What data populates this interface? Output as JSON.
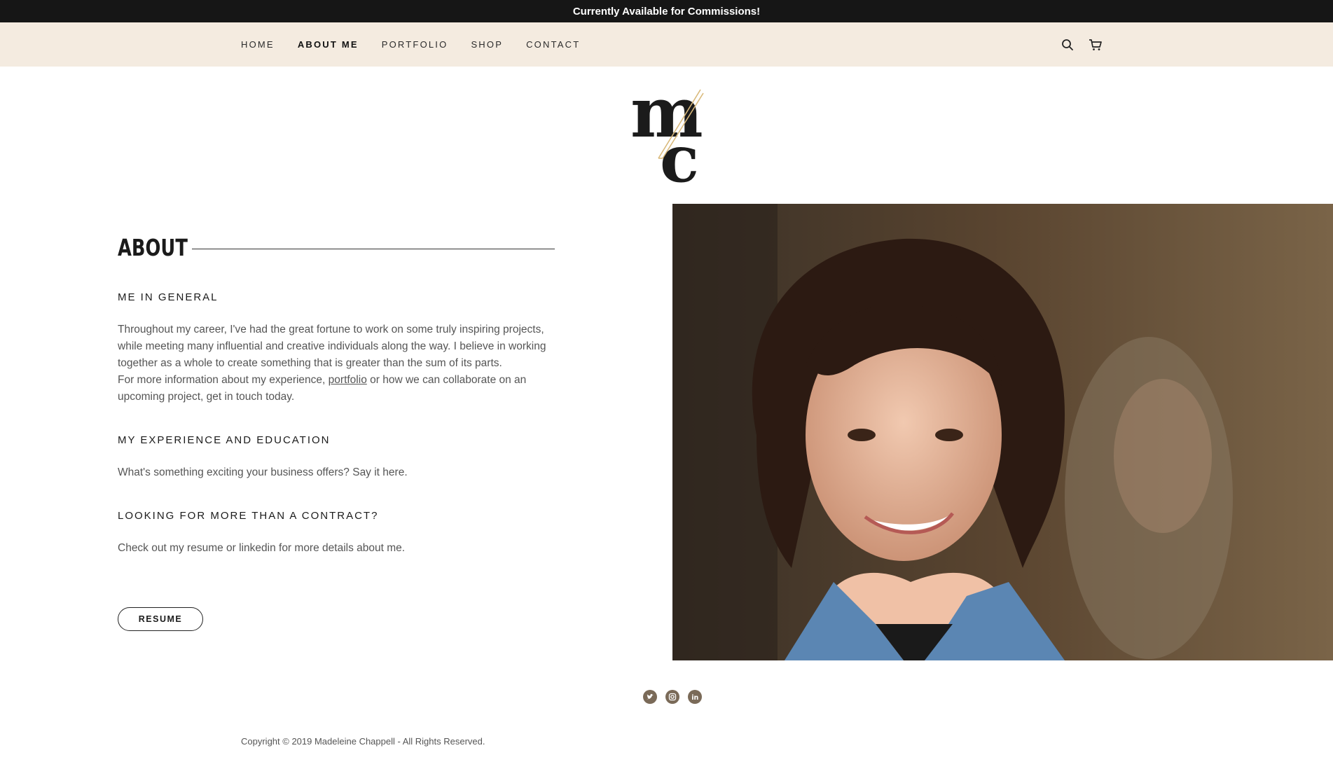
{
  "announcement": "Currently Available for Commissions!",
  "nav": {
    "items": [
      {
        "label": "HOME"
      },
      {
        "label": "ABOUT ME"
      },
      {
        "label": "PORTFOLIO"
      },
      {
        "label": "SHOP"
      },
      {
        "label": "CONTACT"
      }
    ],
    "active": "ABOUT ME",
    "icons": [
      "search-icon",
      "cart-icon"
    ]
  },
  "about": {
    "heading": "ABOUT",
    "sections": [
      {
        "title": "ME IN GENERAL",
        "text1": " Throughout my career, I've had the great fortune to work on some truly inspiring projects, while meeting many influential and creative individuals along the way. I believe in working together as a whole to create something that is greater than the sum of its parts.",
        "text2_before": "For more information about my experience, ",
        "link": "portfolio",
        "text2_after": " or how we can collaborate on an upcoming project, get in touch today."
      },
      {
        "title": "MY EXPERIENCE AND EDUCATION",
        "text": "What's something exciting your business offers? Say it here."
      },
      {
        "title": "LOOKING FOR MORE THAN A CONTRACT?",
        "text": "Check out my resume or linkedin for more details about me."
      }
    ],
    "button": "RESUME"
  },
  "social": [
    "twitter-icon",
    "instagram-icon",
    "linkedin-icon"
  ],
  "footer": {
    "copyright": "Copyright © 2019 Madeleine Chappell - All Rights Reserved."
  },
  "colors": {
    "announcement_bg": "#161616",
    "nav_bg": "#f4ebe0",
    "social": "#7a6a58",
    "logo_accent": "#d9b97a"
  }
}
